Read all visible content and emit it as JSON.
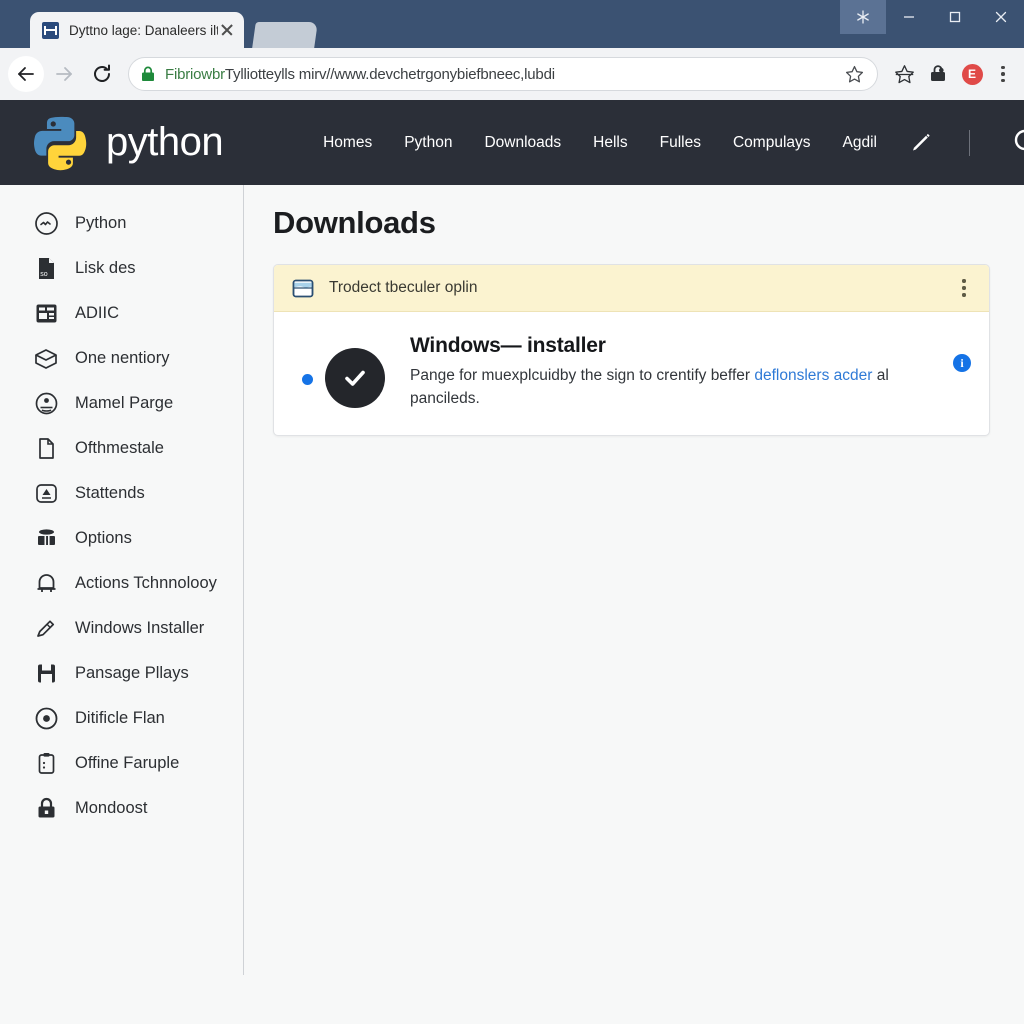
{
  "window": {
    "tab_title": "Dyttno lage: Danaleers iltrou..",
    "controls": {
      "extra": "snowflake-button",
      "minimize": "minimize-button",
      "maximize": "maximize-button",
      "close": "close-button"
    }
  },
  "toolbar": {
    "back": "back-arrow",
    "forward": "forward-arrow",
    "reload": "reload-arrow",
    "url_scheme": "Fibriowbr",
    "url_rest": "Tylliotteylls mirv//www.devchetrgonybiefbneec,lubdi",
    "bookmark_star": "star-icon",
    "extensions": "extensions-star-icon",
    "profile_lock": "lock-bag-icon",
    "extension_badge": "E",
    "menu": "three-dot-menu"
  },
  "site_header": {
    "brand": "python",
    "nav": [
      {
        "label": "Homes"
      },
      {
        "label": "Python"
      },
      {
        "label": "Downloads"
      },
      {
        "label": "Hells"
      },
      {
        "label": "Fulles"
      },
      {
        "label": "Compulays"
      },
      {
        "label": "Agdil"
      }
    ],
    "pencil_icon": "pencil-icon",
    "search_icon": "search-icon"
  },
  "sidebar": {
    "items": [
      {
        "label": "Python",
        "icon": "python-circle-icon"
      },
      {
        "label": "Lisk des",
        "icon": "document-icon"
      },
      {
        "label": "ADIIC",
        "icon": "layout-icon"
      },
      {
        "label": "One nentiory",
        "icon": "box-icon"
      },
      {
        "label": "Mamel Parge",
        "icon": "face-circle-icon"
      },
      {
        "label": "Ofthmestale",
        "icon": "page-icon"
      },
      {
        "label": "Stattends",
        "icon": "badge-icon"
      },
      {
        "label": "Options",
        "icon": "drum-icon"
      },
      {
        "label": "Actions Tchnnolooy",
        "icon": "bell-icon"
      },
      {
        "label": "Windows Installer",
        "icon": "pencil-icon"
      },
      {
        "label": "Pansage Pllays",
        "icon": "save-icon"
      },
      {
        "label": "Ditificle Flan",
        "icon": "target-icon"
      },
      {
        "label": "Offine Faruple",
        "icon": "clipboard-icon"
      },
      {
        "label": "Mondoost",
        "icon": "lock-icon"
      }
    ]
  },
  "main": {
    "title": "Downloads",
    "banner": {
      "icon": "folder-icon",
      "text": "Trodect tbeculer oplin",
      "menu": "banner-three-dot-menu"
    },
    "download_row": {
      "status_dot": "selected-dot",
      "status_icon": "check-circle-icon",
      "title": "Windows— installer",
      "desc_before": "Pange for muexplcuidby the sign to crentify beffer ",
      "desc_link": "deflonslers acder",
      "desc_after": " al pancileds.",
      "info_badge": "i"
    }
  },
  "colors": {
    "titlebar": "#3b5272",
    "site_header": "#2b2f38",
    "banner": "#fbf3d0",
    "accent_blue": "#1573e6",
    "link_blue": "#2f7ad6",
    "dark_circle": "#24262b"
  }
}
